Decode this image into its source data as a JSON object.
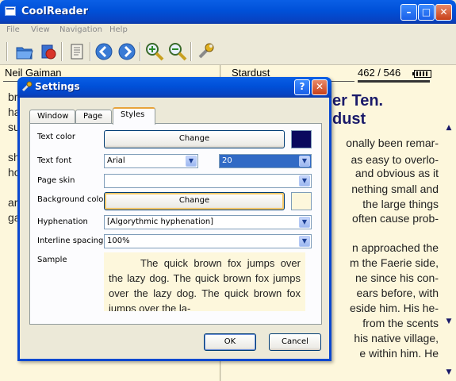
{
  "window": {
    "title": "CoolReader",
    "buttons": {
      "minimize": "–",
      "maximize": "□",
      "close": "✕"
    }
  },
  "menu": [
    "File",
    "View",
    "Navigation",
    "Help"
  ],
  "toolbar": {
    "icons": [
      "open-folder-icon",
      "recent-books-icon",
      "table-of-contents-icon",
      "back-arrow-icon",
      "forward-arrow-icon",
      "zoom-in-icon",
      "zoom-out-icon",
      "settings-wrench-icon"
    ]
  },
  "left_page": {
    "author": "Neil Gaiman",
    "lines": [
      "br",
      "ha",
      "su",
      "sh",
      "ho",
      "ar",
      "ga"
    ]
  },
  "right_page": {
    "book_title": "Stardust",
    "page_indicator": "462 / 546",
    "progress": 0.846,
    "chapter_line1": "er Ten.",
    "chapter_line2": "dust",
    "lines": [
      "onally been remar-",
      "as easy to overlo-",
      "and obvious as it",
      "nething small and",
      "the large things",
      "often cause prob-",
      "n approached the",
      "m the Faerie side,",
      "ne since his con-",
      "ears before, with",
      "eside him. His he-",
      "from the scents",
      "his native village,",
      "e within him. He"
    ]
  },
  "dialog": {
    "title": "Settings",
    "help_glyph": "?",
    "close_glyph": "✕",
    "tabs": [
      "Window",
      "Page",
      "Styles"
    ],
    "active_tab": "Styles",
    "text_color_label": "Text color",
    "text_color_button": "Change",
    "text_color_value": "#0a0a5e",
    "text_font_label": "Text font",
    "text_font_value": "Arial",
    "text_size_value": "20",
    "page_skin_label": "Page skin",
    "page_skin_value": "",
    "background_color_label": "Background color",
    "background_color_button": "Change",
    "background_color_value": "#fdf7dc",
    "hyphenation_label": "Hyphenation",
    "hyphenation_value": "[Algorythmic hyphenation]",
    "interline_label": "Interline spacing",
    "interline_value": "100%",
    "sample_label": "Sample",
    "sample_text": "The quick brown fox jumps over the lazy dog. The quick brown fox jumps over the lazy dog. The quick brown fox jumps over the la-",
    "ok_label": "OK",
    "cancel_label": "Cancel"
  },
  "colors": {
    "titlebar": "#0050d8",
    "page_background": "#fdf7dc",
    "chapter_title": "#1a1a6a",
    "selection": "#316ac5"
  }
}
